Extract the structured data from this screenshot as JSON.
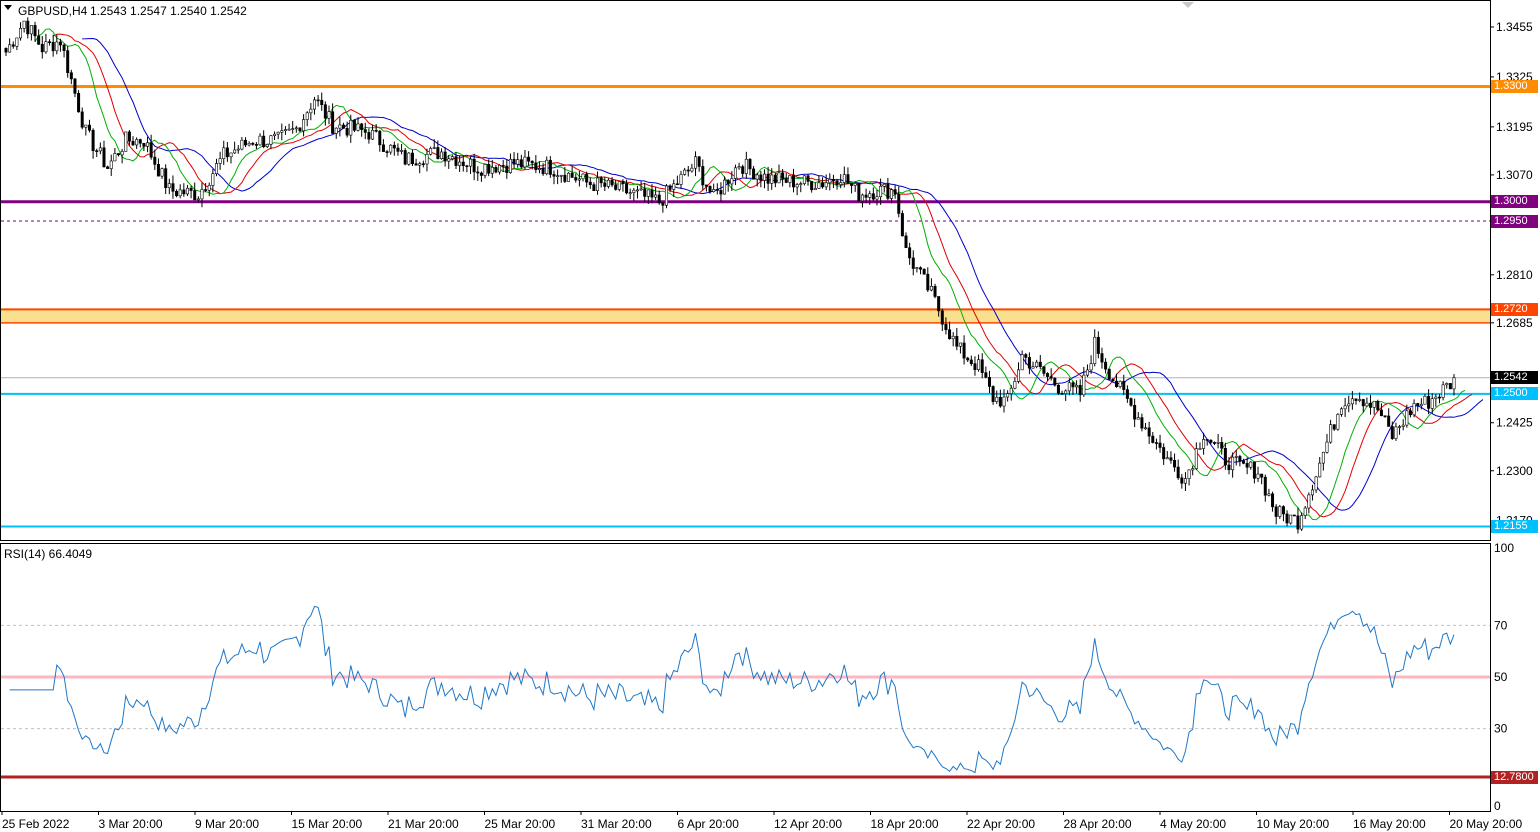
{
  "header": {
    "symbol": "GBPUSD,H4",
    "ohlc": "1.2543 1.2547 1.2540 1.2542"
  },
  "price_axis": {
    "ticks": [
      "1.3455",
      "1.3325",
      "1.3195",
      "1.3070",
      "1.2810",
      "1.2685",
      "1.2425",
      "1.2300",
      "1.2170"
    ],
    "current_price": "1.2542"
  },
  "levels": [
    {
      "label": "1.3300",
      "color": "#ff8c00",
      "price": 1.33
    },
    {
      "label": "1.3000",
      "color": "#800080",
      "price": 1.3
    },
    {
      "label": "1.2950",
      "color": "#800080",
      "price": 1.295
    },
    {
      "label": "1.2720",
      "color": "#ff4500",
      "price": 1.272
    },
    {
      "label": "1.2500",
      "color": "#00bfff",
      "price": 1.25
    },
    {
      "label": "1.2155",
      "color": "#00bfff",
      "price": 1.2155
    }
  ],
  "zone": {
    "from": 1.2685,
    "to": 1.272,
    "color": "#f8e08e"
  },
  "rsi": {
    "title": "RSI(14) 66.4049",
    "ticks": [
      "100",
      "70",
      "50",
      "30",
      "0"
    ],
    "level_tag": "12.7800",
    "level_color": "#b22222"
  },
  "time_axis": {
    "labels": [
      "25 Feb 2022",
      "3 Mar 20:00",
      "9 Mar 20:00",
      "15 Mar 20:00",
      "21 Mar 20:00",
      "25 Mar 20:00",
      "31 Mar 20:00",
      "6 Apr 20:00",
      "12 Apr 20:00",
      "18 Apr 20:00",
      "22 Apr 20:00",
      "28 Apr 20:00",
      "4 May 20:00",
      "10 May 20:00",
      "16 May 20:00",
      "20 May 20:00"
    ]
  },
  "chart_data": {
    "type": "candlestick",
    "symbol": "GBPUSD",
    "timeframe": "H4",
    "ylim": [
      1.2125,
      1.352
    ],
    "x_labels": [
      "25 Feb 2022",
      "3 Mar 20:00",
      "9 Mar 20:00",
      "15 Mar 20:00",
      "21 Mar 20:00",
      "25 Mar 20:00",
      "31 Mar 20:00",
      "6 Apr 20:00",
      "12 Apr 20:00",
      "18 Apr 20:00",
      "22 Apr 20:00",
      "28 Apr 20:00",
      "4 May 20:00",
      "10 May 20:00",
      "16 May 20:00",
      "20 May 20:00"
    ],
    "price_path": [
      [
        0,
        1.339
      ],
      [
        5,
        1.347
      ],
      [
        10,
        1.34
      ],
      [
        15,
        1.342
      ],
      [
        22,
        1.318
      ],
      [
        28,
        1.309
      ],
      [
        33,
        1.316
      ],
      [
        38,
        1.316
      ],
      [
        45,
        1.303
      ],
      [
        53,
        1.302
      ],
      [
        60,
        1.312
      ],
      [
        68,
        1.316
      ],
      [
        75,
        1.316
      ],
      [
        80,
        1.319
      ],
      [
        85,
        1.327
      ],
      [
        90,
        1.32
      ],
      [
        100,
        1.318
      ],
      [
        110,
        1.311
      ],
      [
        120,
        1.313
      ],
      [
        130,
        1.309
      ],
      [
        140,
        1.31
      ],
      [
        150,
        1.309
      ],
      [
        160,
        1.305
      ],
      [
        170,
        1.303
      ],
      [
        180,
        1.3
      ],
      [
        190,
        1.31
      ],
      [
        195,
        1.301
      ],
      [
        202,
        1.31
      ],
      [
        210,
        1.306
      ],
      [
        220,
        1.305
      ],
      [
        225,
        1.305
      ],
      [
        230,
        1.307
      ],
      [
        235,
        1.302
      ],
      [
        240,
        1.303
      ],
      [
        245,
        1.303
      ],
      [
        248,
        1.287
      ],
      [
        255,
        1.276
      ],
      [
        262,
        1.262
      ],
      [
        268,
        1.257
      ],
      [
        272,
        1.249
      ],
      [
        276,
        1.248
      ],
      [
        280,
        1.26
      ],
      [
        290,
        1.252
      ],
      [
        296,
        1.25
      ],
      [
        300,
        1.263
      ],
      [
        305,
        1.254
      ],
      [
        312,
        1.244
      ],
      [
        320,
        1.233
      ],
      [
        325,
        1.228
      ],
      [
        330,
        1.24
      ],
      [
        336,
        1.233
      ],
      [
        340,
        1.231
      ],
      [
        345,
        1.23
      ],
      [
        350,
        1.219
      ],
      [
        356,
        1.217
      ],
      [
        362,
        1.232
      ],
      [
        368,
        1.248
      ],
      [
        372,
        1.25
      ],
      [
        378,
        1.246
      ],
      [
        382,
        1.239
      ],
      [
        388,
        1.247
      ],
      [
        392,
        1.248
      ],
      [
        400,
        1.2542
      ]
    ],
    "rsi_period": 14,
    "rsi_current": 66.4049,
    "rsi_levels": [
      70,
      50,
      30
    ],
    "rsi_ylim": [
      0,
      100
    ],
    "grid": false
  }
}
